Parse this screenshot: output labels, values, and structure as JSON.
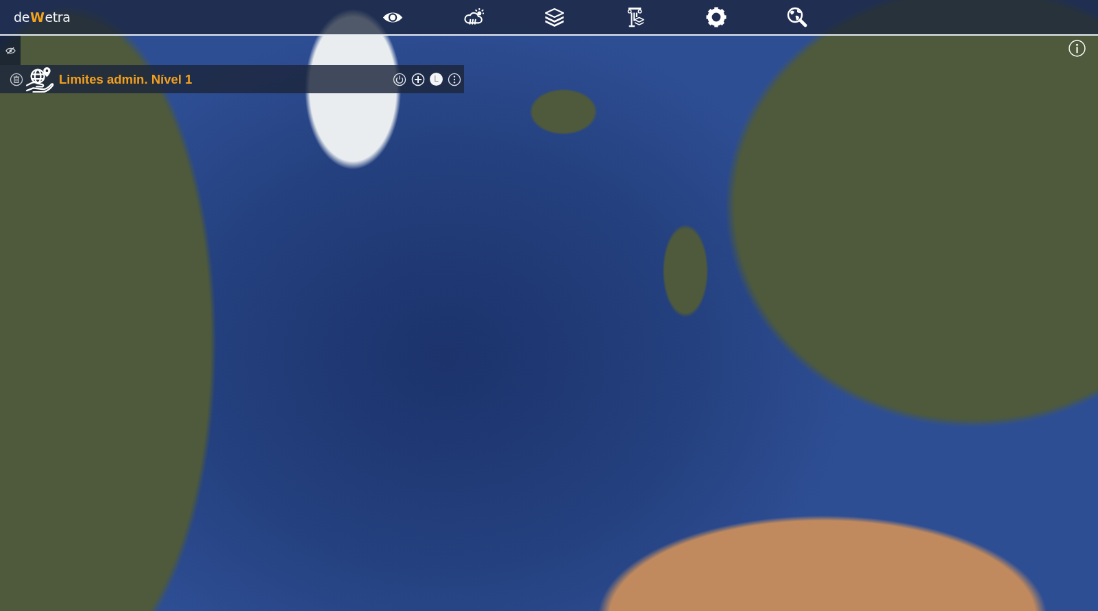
{
  "header": {
    "logo": [
      {
        "text": "de",
        "accent": false
      },
      {
        "text": "W",
        "accent": true
      },
      {
        "text": "etra",
        "accent": false
      }
    ],
    "toolbar": [
      {
        "kind": "eye"
      },
      {
        "kind": "weather"
      },
      {
        "kind": "layers"
      },
      {
        "kind": "column"
      },
      {
        "kind": "settings"
      },
      {
        "kind": "globe-search"
      }
    ]
  },
  "layer_panel": {
    "title": "Limites admin. Nível 1",
    "actions": [
      {
        "kind": "power"
      },
      {
        "kind": "add"
      },
      {
        "kind": "letter",
        "label": "L"
      },
      {
        "kind": "more"
      }
    ]
  }
}
